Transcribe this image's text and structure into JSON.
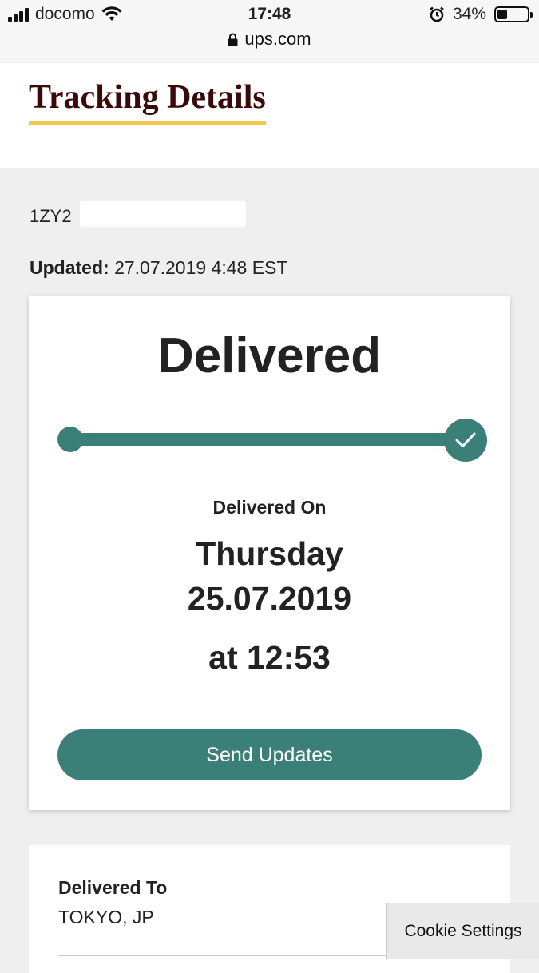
{
  "status_bar": {
    "carrier": "docomo",
    "time": "17:48",
    "battery": "34%",
    "battery_level": 0.34,
    "url": "ups.com"
  },
  "header": {
    "title": "Tracking Details"
  },
  "tracking": {
    "number": "1ZY2",
    "updated_label": "Updated:",
    "updated_value": "27.07.2019 4:48 EST"
  },
  "status_card": {
    "status": "Delivered",
    "progress": 1.0,
    "delivered_on_label": "Delivered On",
    "day": "Thursday",
    "date": "25.07.2019",
    "time": "at 12:53",
    "send_updates_label": "Send Updates"
  },
  "delivered_to": {
    "label": "Delivered To",
    "value": "TOKYO, JP"
  },
  "cookie": {
    "label": "Cookie Settings"
  },
  "colors": {
    "accent": "#3b8078",
    "title": "#3a0a0a",
    "underline": "#f2c94c"
  }
}
